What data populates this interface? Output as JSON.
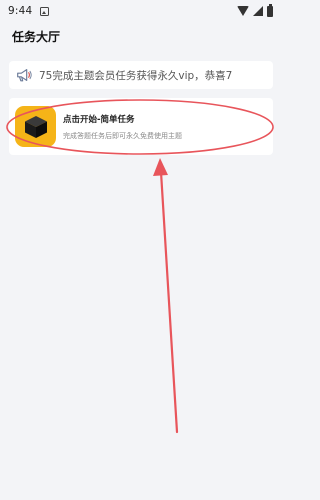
{
  "status_bar": {
    "time": "9:44",
    "icons": [
      "image-icon",
      "wifi-icon",
      "signal-icon",
      "battery-icon"
    ]
  },
  "header": {
    "title": "任务大厅"
  },
  "notice": {
    "icon": "megaphone-icon",
    "text": "75完成主题会员任务获得永久vip，恭喜7"
  },
  "tasks": [
    {
      "icon": "black-box-icon",
      "title": "点击开始-简单任务",
      "description": "完成答题任务后即可永久免费使用主题"
    }
  ],
  "annotation": {
    "color": "#e8555b",
    "shapes": [
      "ellipse-highlight",
      "arrow-pointing-up"
    ]
  }
}
